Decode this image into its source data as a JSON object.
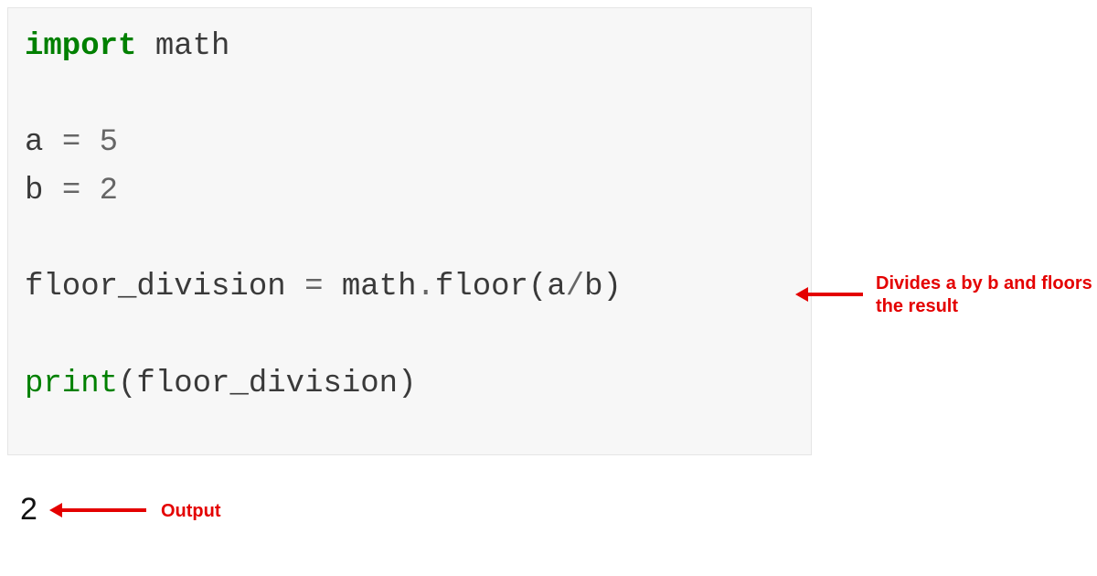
{
  "code": {
    "lines": [
      {
        "tokens": [
          {
            "text": "import",
            "class": "tok-keyword"
          },
          {
            "text": " math",
            "class": "tok-plain"
          }
        ]
      },
      {
        "tokens": [
          {
            "text": "",
            "class": "tok-plain"
          }
        ]
      },
      {
        "tokens": [
          {
            "text": "a ",
            "class": "tok-plain"
          },
          {
            "text": "=",
            "class": "tok-op"
          },
          {
            "text": " ",
            "class": "tok-plain"
          },
          {
            "text": "5",
            "class": "tok-op"
          }
        ]
      },
      {
        "tokens": [
          {
            "text": "b ",
            "class": "tok-plain"
          },
          {
            "text": "=",
            "class": "tok-op"
          },
          {
            "text": " ",
            "class": "tok-plain"
          },
          {
            "text": "2",
            "class": "tok-op"
          }
        ]
      },
      {
        "tokens": [
          {
            "text": "",
            "class": "tok-plain"
          }
        ]
      },
      {
        "tokens": [
          {
            "text": "floor_division ",
            "class": "tok-plain"
          },
          {
            "text": "=",
            "class": "tok-op"
          },
          {
            "text": " math",
            "class": "tok-plain"
          },
          {
            "text": ".",
            "class": "tok-op"
          },
          {
            "text": "floor(a",
            "class": "tok-plain"
          },
          {
            "text": "/",
            "class": "tok-op"
          },
          {
            "text": "b)",
            "class": "tok-plain"
          }
        ]
      },
      {
        "tokens": [
          {
            "text": "",
            "class": "tok-plain"
          }
        ]
      },
      {
        "tokens": [
          {
            "text": "print",
            "class": "tok-builtin"
          },
          {
            "text": "(floor_division)",
            "class": "tok-plain"
          }
        ]
      }
    ]
  },
  "output": {
    "value": "2"
  },
  "annotations": {
    "code_comment": "Divides a by b and floors the result",
    "output_label": "Output"
  },
  "colors": {
    "annotation": "#e40000",
    "keyword": "#008000",
    "operator": "#666666",
    "code_bg": "#f7f7f7"
  }
}
